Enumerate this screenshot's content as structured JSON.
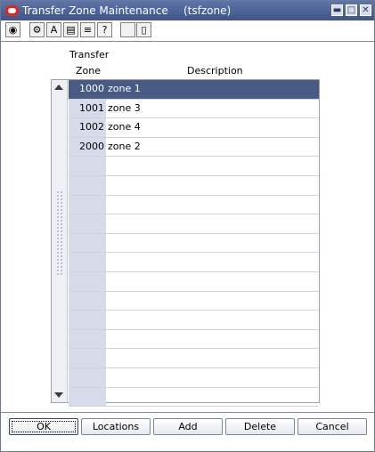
{
  "window": {
    "title": "Transfer Zone Maintenance",
    "subtitle": "(tsfzone)",
    "controls": {
      "minimize": "▬",
      "maximize": "□",
      "close": "✕"
    }
  },
  "toolbar": [
    {
      "icon": "globe-icon",
      "glyph": "◉"
    },
    {
      "icon": "gear-icon",
      "glyph": "⚙"
    },
    {
      "icon": "text-edit-icon",
      "glyph": "A"
    },
    {
      "icon": "document-icon",
      "glyph": "▤"
    },
    {
      "icon": "list-icon",
      "glyph": "≡"
    },
    {
      "icon": "help-icon",
      "glyph": "?"
    },
    {
      "icon": "blank-icon",
      "glyph": ""
    },
    {
      "icon": "page-icon",
      "glyph": "▯"
    }
  ],
  "table": {
    "header_line1": "Transfer",
    "col_zone": "Zone",
    "col_description": "Description",
    "rows": [
      {
        "zone": "1000",
        "description": "zone 1",
        "selected": true
      },
      {
        "zone": "1001",
        "description": "zone 3"
      },
      {
        "zone": "1002",
        "description": "zone 4"
      },
      {
        "zone": "2000",
        "description": "zone 2"
      },
      {
        "zone": "",
        "description": ""
      },
      {
        "zone": "",
        "description": ""
      },
      {
        "zone": "",
        "description": ""
      },
      {
        "zone": "",
        "description": ""
      },
      {
        "zone": "",
        "description": ""
      },
      {
        "zone": "",
        "description": ""
      },
      {
        "zone": "",
        "description": ""
      },
      {
        "zone": "",
        "description": ""
      },
      {
        "zone": "",
        "description": ""
      },
      {
        "zone": "",
        "description": ""
      },
      {
        "zone": "",
        "description": ""
      },
      {
        "zone": "",
        "description": ""
      },
      {
        "zone": "",
        "description": ""
      }
    ]
  },
  "buttons": {
    "ok": "OK",
    "locations": "Locations",
    "add": "Add",
    "delete": "Delete",
    "cancel": "Cancel"
  },
  "colors": {
    "title_bar": "#4a5f94",
    "selected_row": "#485b85",
    "zone_column": "#d5dbe8"
  }
}
